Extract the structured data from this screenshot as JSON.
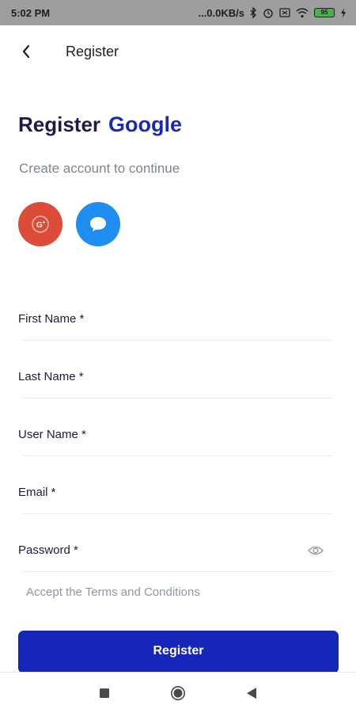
{
  "status_bar": {
    "time": "5:02 PM",
    "network_speed": "...0.0KB/s",
    "battery_level": "95"
  },
  "app_bar": {
    "title": "Register",
    "back_icon": "chevron-left-icon"
  },
  "heading": {
    "main": "Register",
    "brand": "Google",
    "subtitle": "Create account to continue"
  },
  "social": [
    {
      "icon": "google-plus-icon",
      "color": "#dd4b39"
    },
    {
      "icon": "chat-bubble-icon",
      "color": "#1e8ff0"
    }
  ],
  "form": {
    "first_name_label": "First Name *",
    "last_name_label": "Last Name *",
    "user_name_label": "User Name *",
    "email_label": "Email *",
    "password_label": "Password *",
    "password_toggle_icon": "eye-icon",
    "terms_text": "Accept the Terms and Conditions",
    "submit_label": "Register"
  },
  "colors": {
    "primary": "#1626b8",
    "brand_text": "#1a2bb0"
  },
  "nav_bar": {
    "icons": [
      "square-icon",
      "circle-icon",
      "triangle-back-icon"
    ]
  }
}
